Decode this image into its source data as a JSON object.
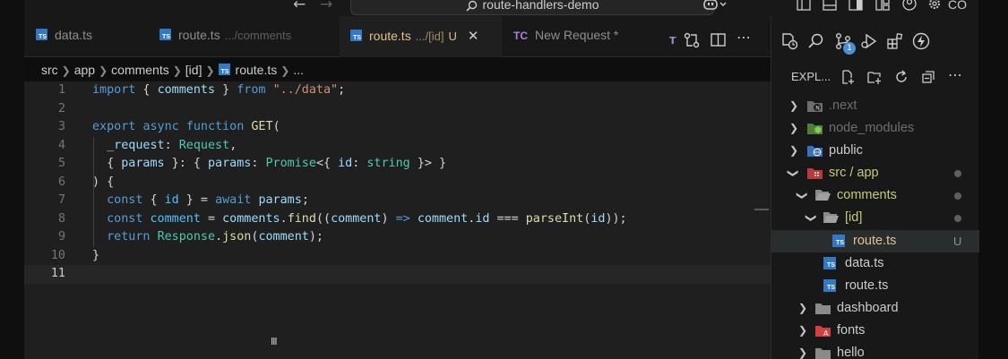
{
  "titlebar": {
    "search_text": "route-handlers-demo",
    "account_text": "CO"
  },
  "tabs": [
    {
      "name": "data.ts",
      "description": "",
      "type": "ts",
      "active": false
    },
    {
      "name": "route.ts",
      "description": ".../comments",
      "type": "ts",
      "active": false
    },
    {
      "name": "route.ts",
      "description": ".../[id]",
      "badge": "U",
      "type": "ts",
      "active": true
    },
    {
      "name": "New Request *",
      "description": "",
      "type": "tc",
      "prefix": "TC",
      "active": false
    }
  ],
  "tab_actions": {
    "t_label": "T"
  },
  "breadcrumb": {
    "segments": [
      "src",
      "app",
      "comments",
      "[id]"
    ],
    "file": "route.ts",
    "ellipsis": "..."
  },
  "editor": {
    "current_line": 11,
    "line_numbers": [
      "1",
      "2",
      "3",
      "4",
      "5",
      "6",
      "7",
      "8",
      "9",
      "10",
      "11"
    ]
  },
  "sidebar": {
    "explorer_title": "EXPL...",
    "badge_count": "1",
    "tree": [
      {
        "label": ".next",
        "kind": "folder",
        "icon": "next-folder-icon",
        "expanded": false,
        "dim": true
      },
      {
        "label": "node_modules",
        "kind": "folder",
        "icon": "node-folder-icon",
        "expanded": false,
        "dim": true
      },
      {
        "label": "public",
        "kind": "folder",
        "icon": "public-folder-icon",
        "expanded": false
      },
      {
        "label": "src / app",
        "kind": "folder",
        "icon": "src-folder-icon",
        "expanded": true,
        "modified": true
      },
      {
        "label": "comments",
        "kind": "folder",
        "icon": "folder-open-icon",
        "expanded": true,
        "modified": true
      },
      {
        "label": "[id]",
        "kind": "folder",
        "icon": "folder-open-icon",
        "expanded": true,
        "modified": true
      },
      {
        "label": "route.ts",
        "kind": "file",
        "icon": "typescript-icon",
        "status": "U",
        "selected": true
      },
      {
        "label": "data.ts",
        "kind": "file",
        "icon": "typescript-icon"
      },
      {
        "label": "route.ts",
        "kind": "file",
        "icon": "typescript-icon"
      },
      {
        "label": "dashboard",
        "kind": "folder",
        "icon": "folder-icon",
        "expanded": false
      },
      {
        "label": "fonts",
        "kind": "folder",
        "icon": "fonts-folder-icon",
        "expanded": false
      },
      {
        "label": "hello",
        "kind": "folder",
        "icon": "folder-icon",
        "expanded": false
      }
    ]
  },
  "colors": {
    "editor_bg": "#1f1f1f",
    "sidebar_bg": "#181818",
    "modified_tab": "#e2c08d",
    "typescript": "#3178c6",
    "keyword": "#569cd6",
    "function": "#dcdcaa",
    "string": "#ce9178",
    "type": "#4ec9b0"
  }
}
